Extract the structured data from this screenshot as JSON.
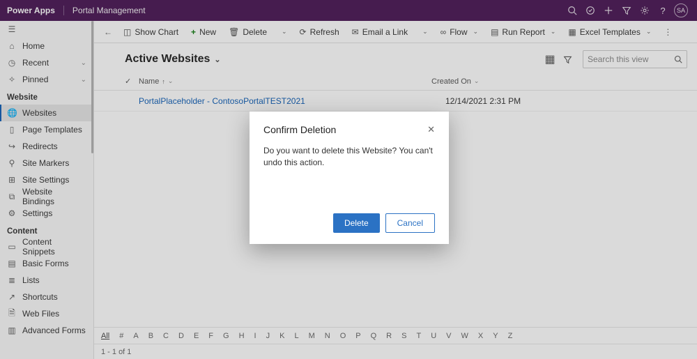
{
  "header": {
    "app_name": "Power Apps",
    "portal_name": "Portal Management",
    "avatar_initials": "SA"
  },
  "sidebar": {
    "top": [
      {
        "icon": "home",
        "label": "Home"
      },
      {
        "icon": "recent",
        "label": "Recent",
        "chevron": true
      },
      {
        "icon": "pinned",
        "label": "Pinned",
        "chevron": true
      }
    ],
    "website_section_label": "Website",
    "website_items": [
      {
        "icon": "globe",
        "label": "Websites",
        "active": true
      },
      {
        "icon": "page",
        "label": "Page Templates"
      },
      {
        "icon": "redirect",
        "label": "Redirects"
      },
      {
        "icon": "marker",
        "label": "Site Markers"
      },
      {
        "icon": "settings-grid",
        "label": "Site Settings"
      },
      {
        "icon": "binding",
        "label": "Website Bindings"
      },
      {
        "icon": "gear",
        "label": "Settings"
      }
    ],
    "content_section_label": "Content",
    "content_items": [
      {
        "icon": "snippet",
        "label": "Content Snippets"
      },
      {
        "icon": "form",
        "label": "Basic Forms"
      },
      {
        "icon": "list",
        "label": "Lists"
      },
      {
        "icon": "shortcut",
        "label": "Shortcuts"
      },
      {
        "icon": "webfile",
        "label": "Web Files"
      },
      {
        "icon": "advform",
        "label": "Advanced Forms"
      }
    ]
  },
  "cmdbar": {
    "show_chart": "Show Chart",
    "new": "New",
    "delete": "Delete",
    "refresh": "Refresh",
    "email": "Email a Link",
    "flow": "Flow",
    "run_report": "Run Report",
    "excel": "Excel Templates"
  },
  "view": {
    "title": "Active Websites",
    "search_placeholder": "Search this view"
  },
  "grid": {
    "col_name": "Name",
    "col_created": "Created On",
    "rows": [
      {
        "name": "PortalPlaceholder - ContosoPortalTEST2021",
        "created": "12/14/2021 2:31 PM"
      }
    ]
  },
  "alpha": {
    "all_label": "All",
    "letters": [
      "#",
      "A",
      "B",
      "C",
      "D",
      "E",
      "F",
      "G",
      "H",
      "I",
      "J",
      "K",
      "L",
      "M",
      "N",
      "O",
      "P",
      "Q",
      "R",
      "S",
      "T",
      "U",
      "V",
      "W",
      "X",
      "Y",
      "Z"
    ]
  },
  "footer": {
    "text": "1 - 1 of 1"
  },
  "dialog": {
    "title": "Confirm Deletion",
    "body": "Do you want to delete this Website? You can't undo this action.",
    "delete_label": "Delete",
    "cancel_label": "Cancel"
  }
}
